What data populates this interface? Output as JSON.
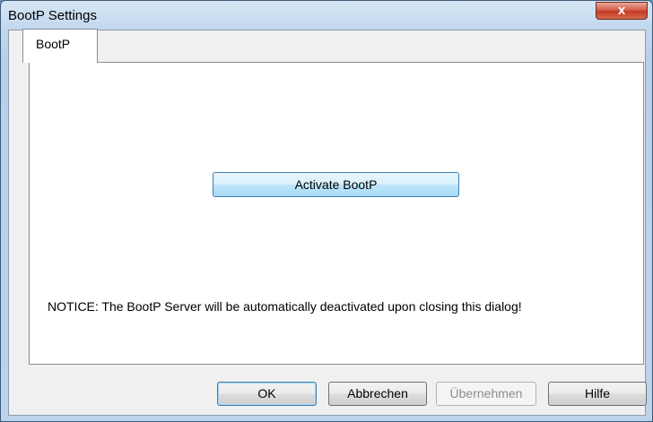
{
  "window": {
    "title": "BootP Settings",
    "close_label": "x"
  },
  "tabs": [
    {
      "label": "BootP",
      "selected": true
    }
  ],
  "panel": {
    "activate_label": "Activate BootP",
    "notice": "NOTICE:  The BootP Server will be automatically deactivated upon closing this dialog!"
  },
  "footer": {
    "ok_label": "OK",
    "cancel_label": "Abbrechen",
    "apply_label": "Übernehmen",
    "apply_enabled": false,
    "help_label": "Hilfe"
  },
  "colors": {
    "close_button": "#c23b22",
    "accent_border": "#3c7fb1",
    "dialog_background": "#f0f0f0"
  }
}
